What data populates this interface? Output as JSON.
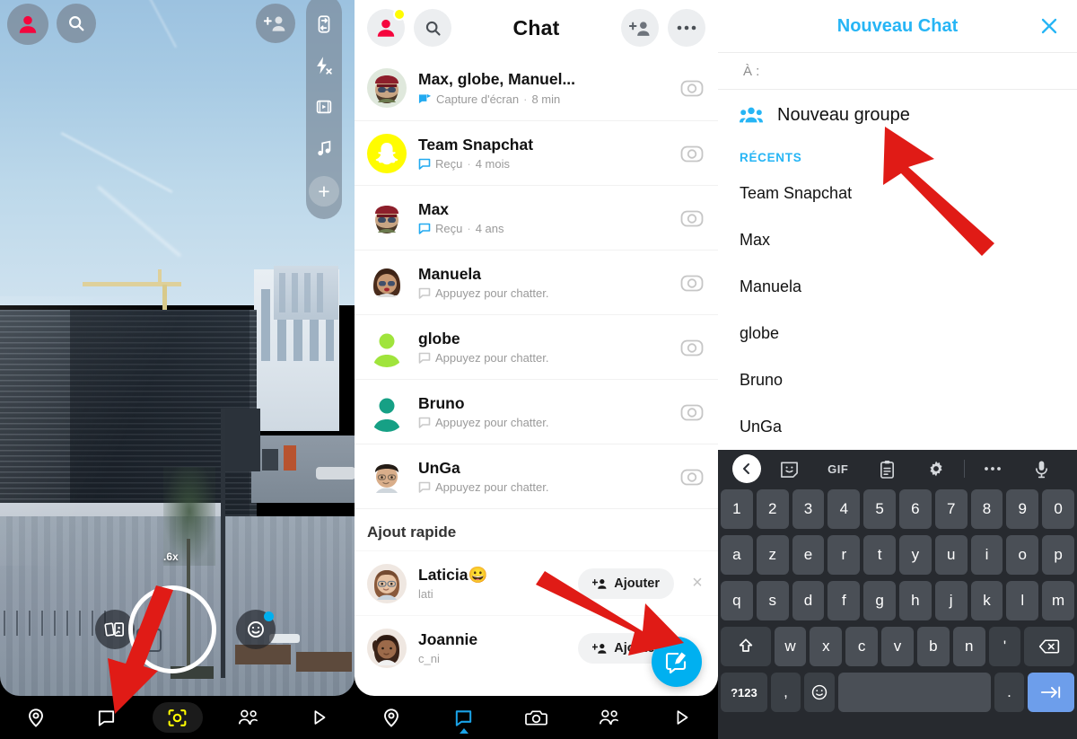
{
  "camera": {
    "zoom_level": ".6x",
    "top_icons": [
      {
        "name": "profile-avatar",
        "label": "Profil"
      },
      {
        "name": "search-icon",
        "label": "Rechercher"
      },
      {
        "name": "add-friend-icon",
        "label": "Ajouter des amis"
      }
    ],
    "side_tools": [
      {
        "name": "flip-camera-icon",
        "label": "Retourner"
      },
      {
        "name": "flash-off-icon",
        "label": "Flash désactivé"
      },
      {
        "name": "timer-icon",
        "label": "Minuteur"
      },
      {
        "name": "music-icon",
        "label": "Musique"
      },
      {
        "name": "more-tools-icon",
        "label": "Plus"
      }
    ],
    "shutter_label": "Capturer",
    "memories_label": "Souvenirs",
    "lens_label": "Lentilles",
    "nav": [
      {
        "name": "map",
        "label": "Carte",
        "active": false
      },
      {
        "name": "chat",
        "label": "Chat",
        "active": false
      },
      {
        "name": "camera",
        "label": "Appareil photo",
        "active": true
      },
      {
        "name": "stories",
        "label": "Stories",
        "active": false
      },
      {
        "name": "spotlight",
        "label": "Spotlight",
        "active": false
      }
    ]
  },
  "chat": {
    "header": {
      "title": "Chat",
      "avatar_label": "Profil",
      "search_label": "Rechercher",
      "add_friend_label": "Ajouter des amis",
      "more_label": "Plus d'options"
    },
    "rows": [
      {
        "name": "Max, globe, Manuel...",
        "status": "Capture d'écran",
        "time": "8 min",
        "icon": "screenshot",
        "avatar": "bitmoji-max-group"
      },
      {
        "name": "Team Snapchat",
        "status": "Reçu",
        "time": "4 mois",
        "icon": "chat",
        "avatar": "snapchat-ghost"
      },
      {
        "name": "Max",
        "status": "Reçu",
        "time": "4 ans",
        "icon": "chat",
        "avatar": "bitmoji-max"
      },
      {
        "name": "Manuela",
        "status": "Appuyez pour chatter.",
        "time": "",
        "icon": "chat",
        "avatar": "bitmoji-manuela"
      },
      {
        "name": "globe",
        "status": "Appuyez pour chatter.",
        "time": "",
        "icon": "chat",
        "avatar": "silhouette-green"
      },
      {
        "name": "Bruno",
        "status": "Appuyez pour chatter.",
        "time": "",
        "icon": "chat",
        "avatar": "silhouette-teal"
      },
      {
        "name": "UnGa",
        "status": "Appuyez pour chatter.",
        "time": "",
        "icon": "chat",
        "avatar": "bitmoji-unga"
      }
    ],
    "quick_add": {
      "title": "Ajout rapide",
      "items": [
        {
          "name": "Laticia😀",
          "username": "lati",
          "button": "Ajouter",
          "dismiss": "×"
        },
        {
          "name": "Joannie",
          "username": "c_ni",
          "button": "Ajouter",
          "dismiss": ""
        }
      ]
    },
    "fab_label": "Nouveau Chat",
    "nav": [
      {
        "name": "map",
        "label": "Carte",
        "active": false
      },
      {
        "name": "chat",
        "label": "Chat",
        "active": true
      },
      {
        "name": "camera",
        "label": "Appareil photo",
        "active": false
      },
      {
        "name": "stories",
        "label": "Stories",
        "active": false
      },
      {
        "name": "spotlight",
        "label": "Spotlight",
        "active": false
      }
    ]
  },
  "new_chat": {
    "title": "Nouveau Chat",
    "close_label": "×",
    "to_label": "À :",
    "new_group_label": "Nouveau groupe",
    "recents_label": "RÉCENTS",
    "recents": [
      "Team Snapchat",
      "Max",
      "Manuela",
      "globe",
      "Bruno",
      "UnGa"
    ]
  },
  "keyboard": {
    "toolbar": [
      {
        "name": "back-chevron-icon",
        "label": "‹"
      },
      {
        "name": "sticker-icon",
        "label": "Sticker"
      },
      {
        "name": "gif-icon",
        "label": "GIF"
      },
      {
        "name": "clipboard-icon",
        "label": "Presse-papiers"
      },
      {
        "name": "settings-gear-icon",
        "label": "Paramètres"
      },
      {
        "name": "more-dots-icon",
        "label": "•••"
      },
      {
        "name": "microphone-icon",
        "label": "Micro"
      }
    ],
    "rows": [
      [
        "1",
        "2",
        "3",
        "4",
        "5",
        "6",
        "7",
        "8",
        "9",
        "0"
      ],
      [
        "a",
        "z",
        "e",
        "r",
        "t",
        "y",
        "u",
        "i",
        "o",
        "p"
      ],
      [
        "q",
        "s",
        "d",
        "f",
        "g",
        "h",
        "j",
        "k",
        "l",
        "m"
      ]
    ],
    "row4": [
      "w",
      "x",
      "c",
      "v",
      "b",
      "n",
      "'"
    ],
    "shift_label": "⇧",
    "backspace_label": "⌫",
    "symbols_label": "?123",
    "comma_label": ",",
    "emoji_label": "☺",
    "space_label": "",
    "period_label": ".",
    "enter_label": "→|"
  },
  "colors": {
    "snapchat_yellow": "#FFFC00",
    "accent_blue": "#26b5f5",
    "fab_blue": "#00b0f0",
    "arrow_red": "#e01b16",
    "keyboard_bg": "#272a2f",
    "key_bg": "#4a4f56",
    "enter_key_blue": "#6d9eeb"
  }
}
